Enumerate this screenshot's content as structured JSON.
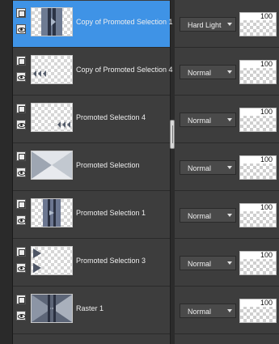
{
  "layers": [
    {
      "name": "Copy of Promoted Selection 1",
      "blend": "Hard Light",
      "opacity": "100",
      "selected": true
    },
    {
      "name": "Copy of Promoted Selection 4",
      "blend": "Normal",
      "opacity": "100",
      "selected": false
    },
    {
      "name": "Promoted Selection 4",
      "blend": "Normal",
      "opacity": "100",
      "selected": false
    },
    {
      "name": "Promoted Selection",
      "blend": "Normal",
      "opacity": "100",
      "selected": false
    },
    {
      "name": "Promoted Selection 1",
      "blend": "Normal",
      "opacity": "100",
      "selected": false
    },
    {
      "name": "Promoted Selection 3",
      "blend": "Normal",
      "opacity": "100",
      "selected": false
    },
    {
      "name": "Raster 1",
      "blend": "Normal",
      "opacity": "100",
      "selected": false
    }
  ],
  "icons": {
    "lock": "layer-lock-icon",
    "visibility": "eye-icon",
    "dropdown": "chevron-down-icon",
    "splitter": "splitter-grip-icon"
  },
  "colors": {
    "selection": "#3f93e6",
    "panel": "#3d3d3d",
    "dropdown": "#4a4a4a"
  }
}
